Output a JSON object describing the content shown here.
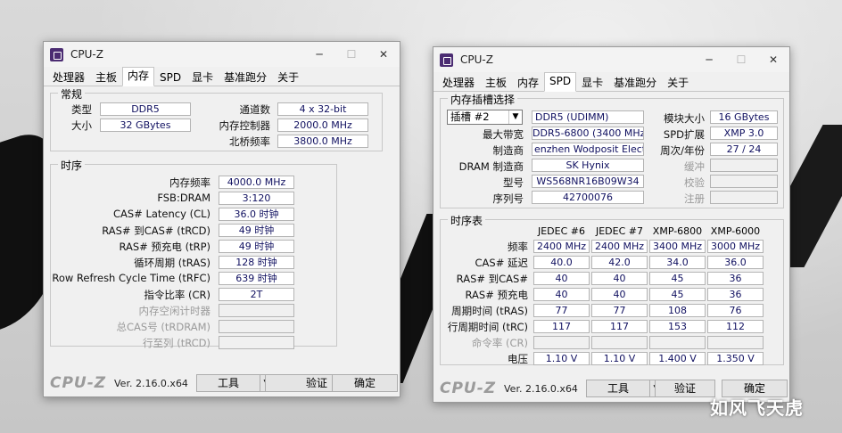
{
  "left": {
    "title": "CPU-Z",
    "tabs": [
      "处理器",
      "主板",
      "内存",
      "SPD",
      "显卡",
      "基准跑分",
      "关于"
    ],
    "general": {
      "label": "常规",
      "type_label": "类型",
      "type_value": "DDR5",
      "size_label": "大小",
      "size_value": "32 GBytes",
      "channels_label": "通道数",
      "channels_value": "4 x 32-bit",
      "controller_label": "内存控制器",
      "controller_value": "2000.0 MHz",
      "nb_label": "北桥频率",
      "nb_value": "3800.0 MHz"
    },
    "timings": {
      "label": "时序",
      "rows": [
        {
          "label": "内存频率",
          "value": "4000.0 MHz",
          "dim": false
        },
        {
          "label": "FSB:DRAM",
          "value": "3:120",
          "dim": false
        },
        {
          "label": "CAS# Latency (CL)",
          "value": "36.0 时钟",
          "dim": false
        },
        {
          "label": "RAS# 到CAS# (tRCD)",
          "value": "49 时钟",
          "dim": false
        },
        {
          "label": "RAS# 预充电 (tRP)",
          "value": "49 时钟",
          "dim": false
        },
        {
          "label": "循环周期 (tRAS)",
          "value": "128 时钟",
          "dim": false
        },
        {
          "label": "Row Refresh Cycle Time (tRFC)",
          "value": "639 时钟",
          "dim": false
        },
        {
          "label": "指令比率 (CR)",
          "value": "2T",
          "dim": false
        },
        {
          "label": "内存空闲计时器",
          "value": "",
          "dim": true
        },
        {
          "label": "总CAS号 (tRDRAM)",
          "value": "",
          "dim": true
        },
        {
          "label": "行至列 (tRCD)",
          "value": "",
          "dim": true
        }
      ]
    },
    "bottom": {
      "logo": "CPU-Z",
      "version": "Ver. 2.16.0.x64",
      "tools": "工具",
      "validate": "验证",
      "ok": "确定"
    }
  },
  "right": {
    "title": "CPU-Z",
    "tabs": [
      "处理器",
      "主板",
      "内存",
      "SPD",
      "显卡",
      "基准跑分",
      "关于"
    ],
    "slot": {
      "label": "内存插槽选择",
      "slot_value": "插槽 #2",
      "module_type": "DDR5 (UDIMM)",
      "module_size_label": "模块大小",
      "module_size_value": "16 GBytes",
      "bandwidth_label": "最大带宽",
      "bandwidth_value": "DDR5-6800 (3400 MHz)",
      "spd_ext_label": "SPD扩展",
      "spd_ext_value": "XMP 3.0",
      "manufacturer_label": "制造商",
      "manufacturer_value": "enzhen Wodposit Electroni",
      "week_year_label": "周次/年份",
      "week_year_value": "27 / 24",
      "dram_label": "DRAM 制造商",
      "dram_value": "SK Hynix",
      "buffered_label": "缓冲",
      "part_label": "型号",
      "part_value": "WS568NR16B09W34",
      "check_label": "校验",
      "serial_label": "序列号",
      "serial_value": "42700076",
      "reg_label": "注册"
    },
    "timings": {
      "label": "时序表",
      "columns": [
        "JEDEC #6",
        "JEDEC #7",
        "XMP-6800",
        "XMP-6000"
      ],
      "rows": [
        {
          "label": "频率",
          "values": [
            "2400 MHz",
            "2400 MHz",
            "3400 MHz",
            "3000 MHz"
          ],
          "dim": false
        },
        {
          "label": "CAS# 延迟",
          "values": [
            "40.0",
            "42.0",
            "34.0",
            "36.0"
          ],
          "dim": false
        },
        {
          "label": "RAS# 到CAS#",
          "values": [
            "40",
            "40",
            "45",
            "36"
          ],
          "dim": false
        },
        {
          "label": "RAS# 预充电",
          "values": [
            "40",
            "40",
            "45",
            "36"
          ],
          "dim": false
        },
        {
          "label": "周期时间 (tRAS)",
          "values": [
            "77",
            "77",
            "108",
            "76"
          ],
          "dim": false
        },
        {
          "label": "行周期时间 (tRC)",
          "values": [
            "117",
            "117",
            "153",
            "112"
          ],
          "dim": false
        },
        {
          "label": "命令率 (CR)",
          "values": [
            "",
            "",
            "",
            ""
          ],
          "dim": true
        },
        {
          "label": "电压",
          "values": [
            "1.10 V",
            "1.10 V",
            "1.400 V",
            "1.350 V"
          ],
          "dim": false
        }
      ]
    },
    "bottom": {
      "logo": "CPU-Z",
      "version": "Ver. 2.16.0.x64",
      "tools": "工具",
      "validate": "验证",
      "ok": "确定"
    }
  },
  "watermark": "如风飞天虎"
}
